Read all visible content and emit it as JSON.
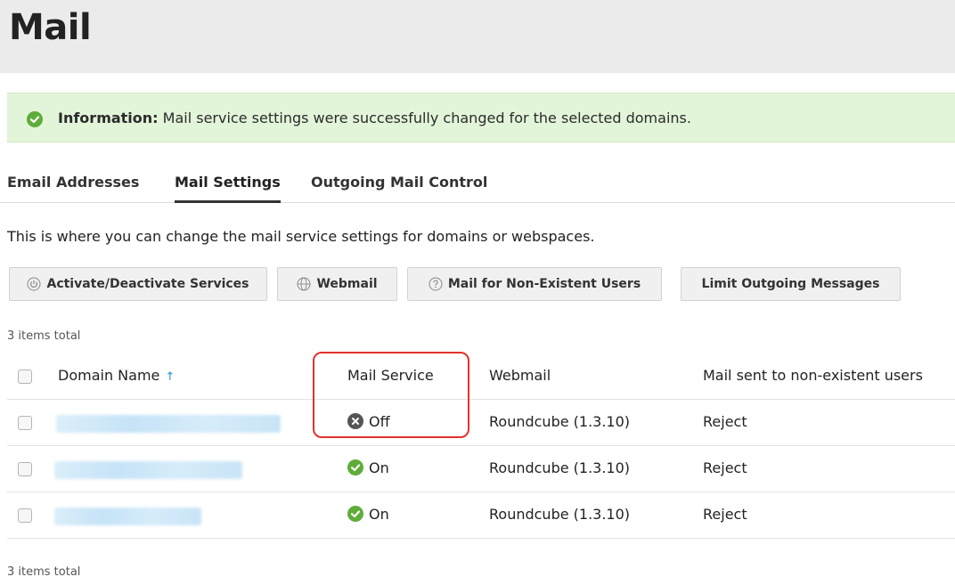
{
  "page": {
    "title": "Mail"
  },
  "info": {
    "label": "Information:",
    "message": " Mail service settings were successfully changed for the selected domains."
  },
  "tabs": [
    {
      "label": "Email Addresses",
      "active": false
    },
    {
      "label": "Mail Settings",
      "active": true
    },
    {
      "label": "Outgoing Mail Control",
      "active": false
    }
  ],
  "description": "This is where you can change the mail service settings for domains or webspaces.",
  "toolbar": {
    "activate": "Activate/Deactivate Services",
    "webmail": "Webmail",
    "nonexistent": "Mail for Non-Existent Users",
    "limit": "Limit Outgoing Messages"
  },
  "items_total": "3 items total",
  "table": {
    "headers": {
      "domain": "Domain Name",
      "sort_indicator": "↑",
      "mail_service": "Mail Service",
      "webmail": "Webmail",
      "nonexistent": "Mail sent to non-existent users"
    },
    "rows": [
      {
        "mail_service": "Off",
        "status": "off",
        "webmail": "Roundcube (1.3.10)",
        "nonexistent": "Reject"
      },
      {
        "mail_service": "On",
        "status": "on",
        "webmail": "Roundcube (1.3.10)",
        "nonexistent": "Reject"
      },
      {
        "mail_service": "On",
        "status": "on",
        "webmail": "Roundcube (1.3.10)",
        "nonexistent": "Reject"
      }
    ]
  },
  "colors": {
    "success_green": "#5fac3a",
    "info_background": "#e2f5d9",
    "highlight_red": "#e0332e",
    "sort_blue": "#2a8fd8"
  },
  "icons": {
    "info": "check-circle-icon",
    "activate": "power-icon",
    "webmail": "globe-icon",
    "nonexistent": "question-circle-icon",
    "status_on": "check-circle-icon",
    "status_off": "x-circle-icon"
  }
}
